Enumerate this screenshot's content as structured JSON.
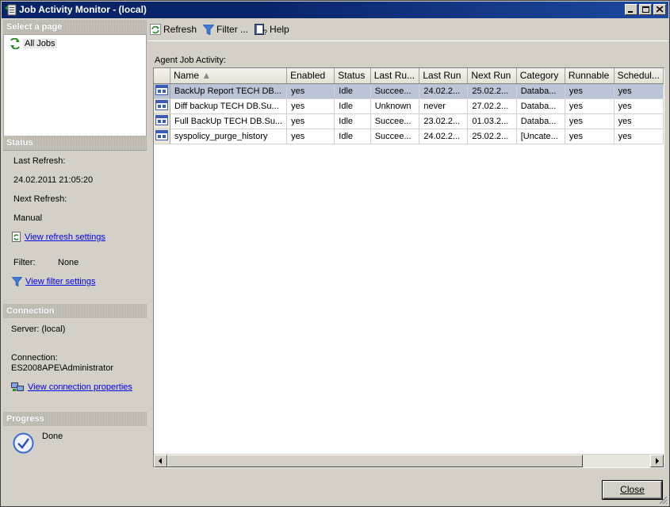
{
  "window": {
    "title": "Job Activity Monitor - (local)"
  },
  "left": {
    "select_page": {
      "header": "Select a page",
      "items": [
        {
          "label": "All Jobs",
          "icon": "refresh-page-icon"
        }
      ]
    },
    "status": {
      "header": "Status",
      "last_refresh_label": "Last Refresh:",
      "last_refresh_value": "24.02.2011 21:05:20",
      "next_refresh_label": "Next Refresh:",
      "next_refresh_value": "Manual",
      "view_refresh_link": "View refresh settings",
      "filter_label": "Filter:",
      "filter_value": "None",
      "view_filter_link": "View filter settings"
    },
    "connection": {
      "header": "Connection",
      "server_text": "Server: (local)",
      "connection_label": "Connection:",
      "connection_value": "ES2008APE\\Administrator",
      "view_connection_link": "View connection properties"
    },
    "progress": {
      "header": "Progress",
      "status": "Done"
    }
  },
  "toolbar": {
    "refresh_label": "Refresh",
    "filter_label": "Filter ...",
    "help_label": "Help"
  },
  "grid": {
    "label": "Agent Job Activity:",
    "columns": [
      "Name",
      "Enabled",
      "Status",
      "Last Ru...",
      "Last Run",
      "Next Run",
      "Category",
      "Runnable",
      "Schedul..."
    ],
    "sort_column": "Name",
    "rows": [
      [
        "BackUp Report TECH DB...",
        "yes",
        "Idle",
        "Succee...",
        "24.02.2...",
        "25.02.2...",
        "Databa...",
        "yes",
        "yes"
      ],
      [
        "Diff backup TECH DB.Su...",
        "yes",
        "Idle",
        "Unknown",
        "never",
        "27.02.2...",
        "Databa...",
        "yes",
        "yes"
      ],
      [
        "Full BackUp TECH DB.Su...",
        "yes",
        "Idle",
        "Succee...",
        "23.02.2...",
        "01.03.2...",
        "Databa...",
        "yes",
        "yes"
      ],
      [
        "syspolicy_purge_history",
        "yes",
        "Idle",
        "Succee...",
        "24.02.2...",
        "25.02.2...",
        "[Uncate...",
        "yes",
        "yes"
      ]
    ],
    "selected_row": 0
  },
  "buttons": {
    "close_label": "Close"
  },
  "colors": {
    "titlebar": "#0a246a",
    "selection": "#bcc5d8",
    "link": "#0000ee",
    "chrome": "#d4d0c8"
  }
}
